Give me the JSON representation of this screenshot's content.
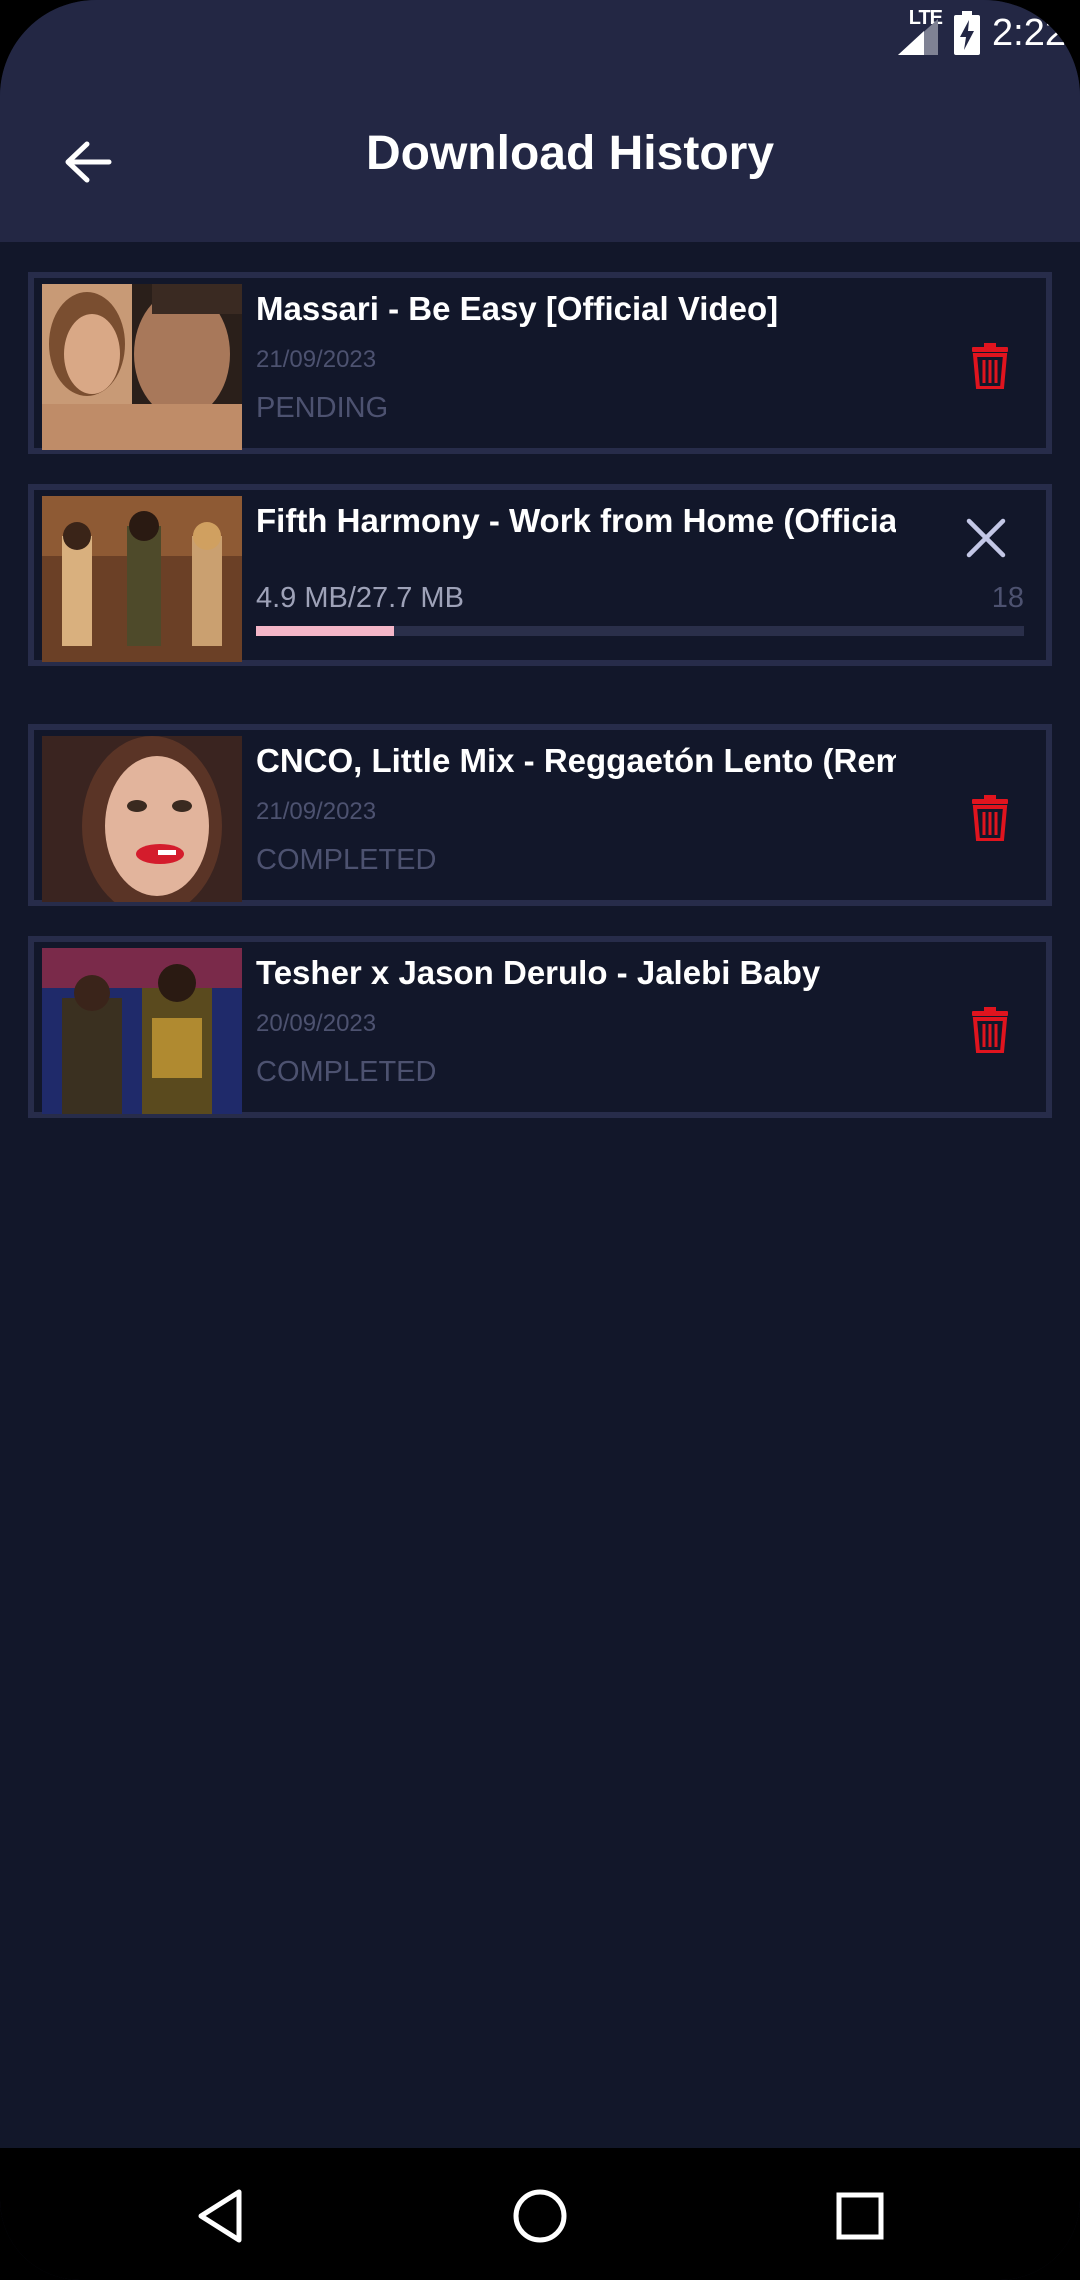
{
  "status_bar": {
    "network": "LTE",
    "time": "2:22"
  },
  "app_bar": {
    "title": "Download History"
  },
  "downloads": [
    {
      "title": "Massari - Be Easy [Official Video]",
      "date": "21/09/2023",
      "status": "PENDING",
      "action_icon": "trash-icon"
    },
    {
      "title": "Fifth Harmony - Work from Home (Official",
      "progress_text": "4.9 MB/27.7 MB",
      "progress_count": "18",
      "progress_fraction": 0.18,
      "action_icon": "close-icon"
    },
    {
      "title": "CNCO, Little Mix - Reggaetón Lento (Remix)",
      "date": "21/09/2023",
      "status": "COMPLETED",
      "action_icon": "trash-icon"
    },
    {
      "title": "Tesher x Jason Derulo - Jalebi Baby",
      "date": "20/09/2023",
      "status": "COMPLETED",
      "action_icon": "trash-icon"
    }
  ],
  "nav_bar": {
    "back_icon": "triangle-back-icon",
    "home_icon": "circle-home-icon",
    "recents_icon": "square-recents-icon"
  },
  "colors": {
    "background": "#12172a",
    "app_bar": "#232744",
    "card_border": "#272c4a",
    "delete_red": "#e0141e",
    "progress_fill": "#f4b6c8"
  }
}
